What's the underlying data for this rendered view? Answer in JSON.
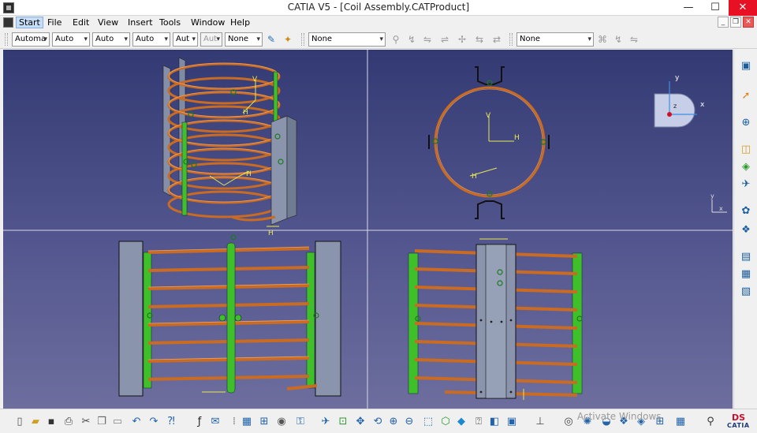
{
  "window": {
    "title": "CATIA V5 - [Coil Assembly.CATProduct]",
    "minimize": "—",
    "maximize": "☐",
    "close": "✕"
  },
  "menu": {
    "items": [
      "Start",
      "File",
      "Edit",
      "View",
      "Insert",
      "Tools",
      "Window",
      "Help"
    ],
    "doc_controls": [
      "_",
      "❐",
      "✕"
    ]
  },
  "toolbar_top": {
    "selects": [
      "Automa",
      "Auto",
      "Auto",
      "Auto",
      "Aut",
      "Aut",
      "None"
    ],
    "select_right_1": "None",
    "select_right_2": "None"
  },
  "viewport": {
    "compass": {
      "x_label": "x",
      "y_label": "y",
      "z_label": "z"
    },
    "axis_small": {
      "x_label": "x",
      "y_label": "y"
    },
    "axis_labels": {
      "h": "H",
      "v": "V"
    }
  },
  "status": {
    "watermark": "Activate Windows"
  },
  "brand": {
    "ds": "DS",
    "name": "CATIA"
  },
  "icons": {
    "top_right": [
      "sketch-icon",
      "brush-icon",
      "constraint-icon",
      "measure-icon",
      "mirror-icon",
      "fix-icon",
      "analysis-icon",
      "bolt-icon",
      "bearing-icon",
      "flash-icon"
    ],
    "right": [
      "model-icon",
      "select-icon",
      "snap-icon",
      "assembly-icon",
      "constraint-icon",
      "camera-icon",
      "material-icon",
      "scene-icon",
      "catalog-icon",
      "filter-icon",
      "generate-icon"
    ],
    "bottom": [
      "new-icon",
      "open-icon",
      "save-icon",
      "print-icon",
      "cut-icon",
      "copy-icon",
      "paste-icon",
      "undo-icon",
      "redo-icon",
      "whatsthis-icon",
      "formula-icon",
      "comment-icon",
      "table-icon",
      "tree-icon",
      "knowledge-icon",
      "catalog-icon",
      "fly-icon",
      "fitall-icon",
      "pan-icon",
      "rotate-icon",
      "zoomin-icon",
      "zoomout-icon",
      "normal-view-icon",
      "iso-view-icon",
      "shading-icon",
      "hide-icon",
      "swap-icon",
      "axis-icon",
      "camera-icon",
      "render-icon",
      "light-icon",
      "walk-icon",
      "fly2-icon",
      "frame-icon",
      "measure-icon",
      "zoom-icon"
    ]
  }
}
